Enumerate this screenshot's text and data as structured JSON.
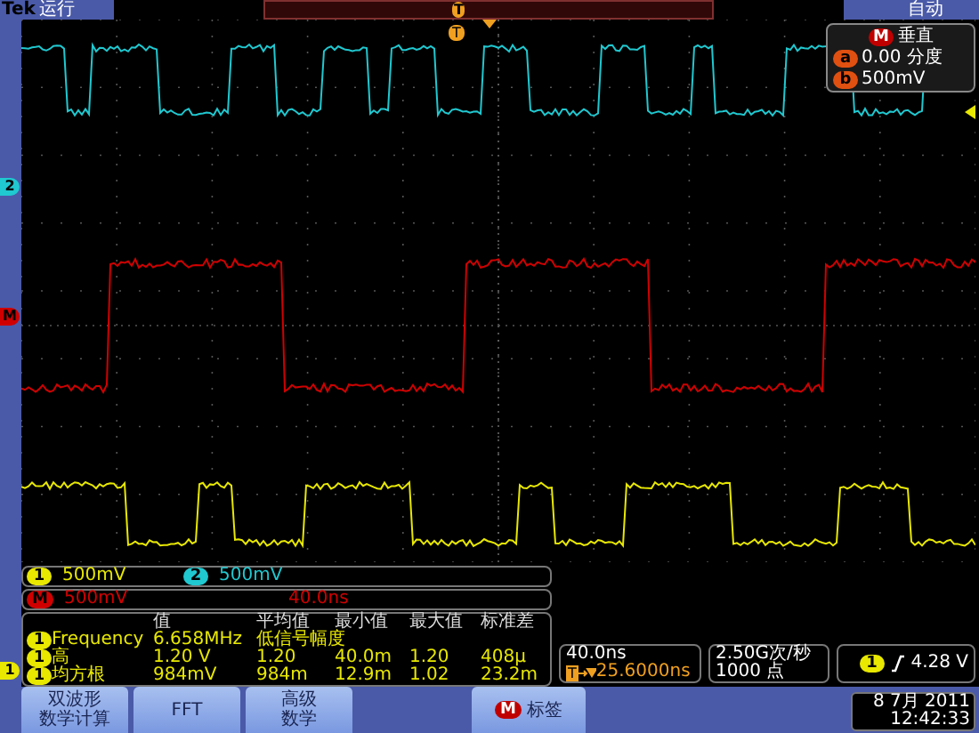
{
  "top_bar": {
    "brand": "Tek",
    "run_state": "运行",
    "trigger_badge": "T",
    "trigger_mode": "自动"
  },
  "graticule": {
    "trigger_badge": "T",
    "markers": [
      "2",
      "M",
      "1"
    ]
  },
  "vertical_overlay": {
    "badge": "M",
    "title": "垂直",
    "rows": [
      {
        "badge": "a",
        "text": "0.00 分度"
      },
      {
        "badge": "b",
        "text": "500mV"
      }
    ]
  },
  "channels": [
    {
      "kind": "analog",
      "badge": "1",
      "scale": "500mV",
      "color": "#e8e800"
    },
    {
      "kind": "analog",
      "badge": "2",
      "scale": "500mV",
      "color": "#20c8d0"
    },
    {
      "kind": "math",
      "badge": "M",
      "scale": "500mV",
      "time": "40.0ns",
      "color": "#d00000"
    }
  ],
  "measurements": {
    "columns": [
      "值",
      "平均值",
      "最小值",
      "最大值",
      "标准差"
    ],
    "rows": [
      {
        "badge": "1",
        "name": "Frequency",
        "cells": [
          "6.658MHz",
          "低信号幅度"
        ]
      },
      {
        "badge": "1",
        "name": "高",
        "cells": [
          "1.20 V",
          "1.20",
          "40.0m",
          "1.20",
          "408µ"
        ]
      },
      {
        "badge": "1",
        "name": "均方根",
        "cells": [
          "984mV",
          "984m",
          "12.9m",
          "1.02",
          "23.2m"
        ]
      }
    ]
  },
  "timebase": {
    "scale": "40.0ns",
    "trigger_badge": "T",
    "delay": "25.6000ns"
  },
  "acquisition": {
    "rate": "2.50G次/秒",
    "points": "1000 点"
  },
  "trigger": {
    "badge": "1",
    "voltage": "4.28 V"
  },
  "buttons": [
    {
      "kind": "menu",
      "lines": [
        "双波形",
        "数学计算"
      ]
    },
    {
      "kind": "menu",
      "lines": [
        "FFT"
      ]
    },
    {
      "kind": "menu",
      "lines": [
        "高级",
        "数学"
      ]
    },
    {
      "kind": "label",
      "badge": "M",
      "lines": [
        "标签"
      ]
    }
  ],
  "datetime": {
    "date": "8 7月 2011",
    "time": "12:42:33"
  }
}
